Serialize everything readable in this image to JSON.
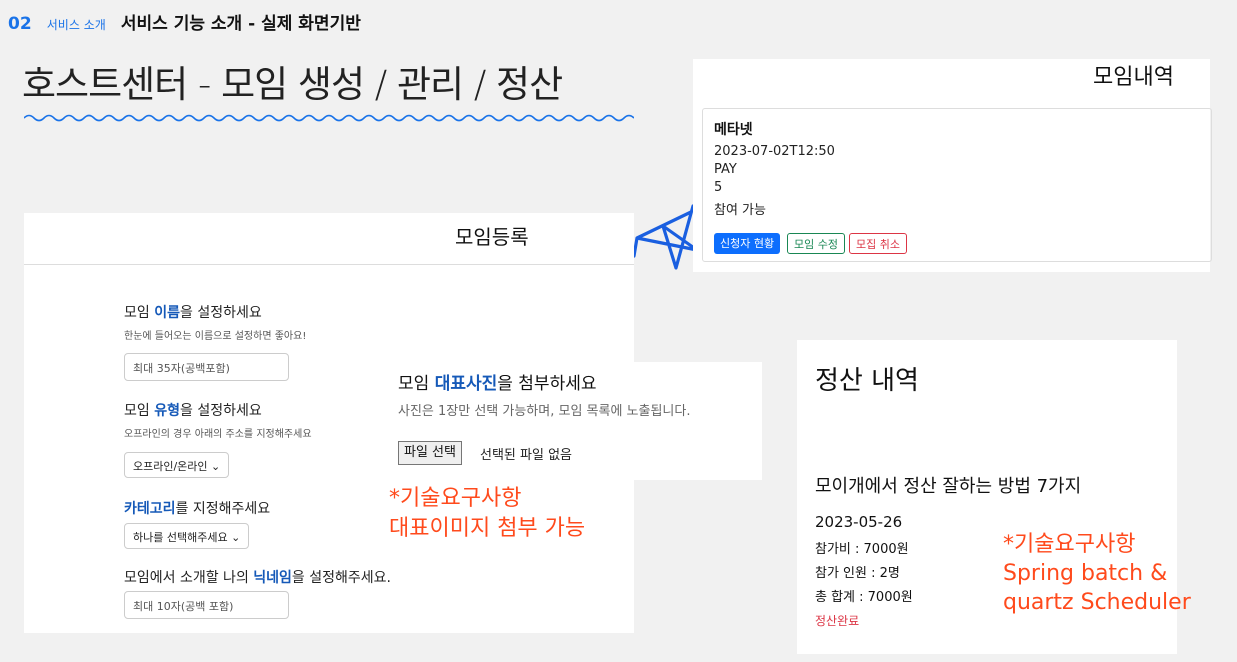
{
  "header": {
    "number": "02",
    "category": "서비스 소개",
    "title": "서비스 기능 소개 - 실제 화면기반"
  },
  "main_title": "호스트센터 - 모임 생성 / 관리 / 정산",
  "list_panel": {
    "title": "모임내역",
    "card": {
      "name": "메타넷",
      "datetime": "2023-07-02T12:50",
      "pay": "PAY",
      "count": "5",
      "status": "참여 가능",
      "buttons": {
        "applicants": "신청자 현황",
        "edit": "모임 수정",
        "cancel": "모집 취소"
      }
    }
  },
  "register_panel": {
    "title": "모임등록",
    "name_q": {
      "pre": "모임 ",
      "em": "이름",
      "post": "을 설정하세요"
    },
    "name_sub": "한눈에 들어오는 이름으로 설정하면 좋아요!",
    "name_placeholder": "최대 35자(공백포함)",
    "type_q": {
      "pre": "모임 ",
      "em": "유형",
      "post": "을 설정하세요"
    },
    "type_sub": "오프라인의 경우 아래의 주소를 지정해주세요",
    "type_select": "오프라인/온라인",
    "cat_q": {
      "em": "카테고리",
      "post": "를 지정해주세요"
    },
    "cat_select": "하나를 선택해주세요",
    "nick_q": {
      "pre": "모임에서 소개할 나의 ",
      "em": "닉네임",
      "post": "을 설정해주세요."
    },
    "nick_placeholder": "최대 10자(공백 포함)"
  },
  "photo_panel": {
    "q": {
      "pre": "모임 ",
      "em": "대표사진",
      "post": "을 첨부하세요"
    },
    "sub": "사진은 1장만 선택 가능하며, 모임 목록에 노출됩니다.",
    "file_button": "파일 선택",
    "no_file": "선택된 파일 없음"
  },
  "note1": [
    "*기술요구사항",
    "대표이미지 첨부 가능"
  ],
  "settle_panel": {
    "title": "정산 내역",
    "item_title": "모이개에서 정산 잘하는 방법 7가지",
    "date": "2023-05-26",
    "fee": "참가비 : 7000원",
    "people": "참가 인원 : 2명",
    "total": "총 합계 : 7000원",
    "status": "정산완료"
  },
  "note2": [
    "*기술요구사항",
    "Spring batch &",
    "quartz Scheduler"
  ],
  "colors": {
    "accent": "#1a73e8",
    "emphasis": "#1559b8",
    "note": "#ff4a1c",
    "primary": "#0d6efd",
    "success": "#198754",
    "danger": "#dc3545"
  }
}
